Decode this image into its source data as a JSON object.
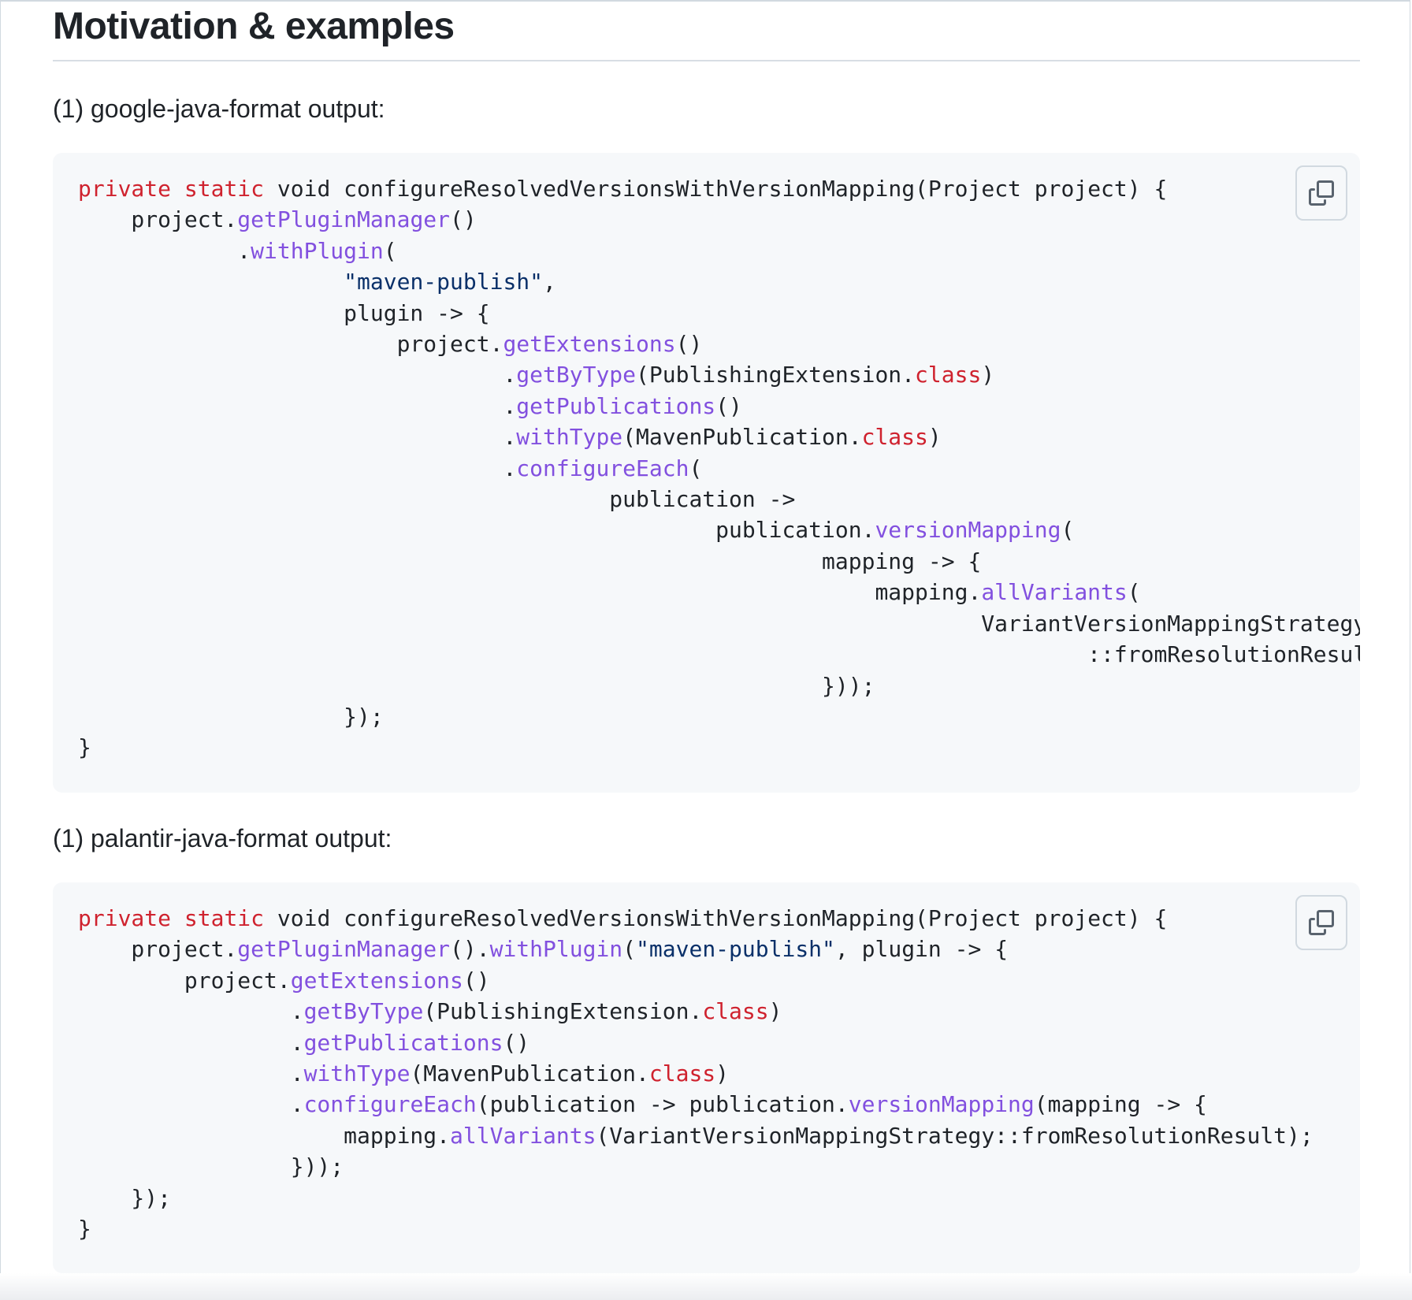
{
  "section": {
    "heading": "Motivation & examples"
  },
  "examples": [
    {
      "caption": "(1) google-java-format output:",
      "copy_icon": "copy-icon",
      "lines": [
        [
          [
            "kw",
            "private"
          ],
          [
            "t",
            " "
          ],
          [
            "kw",
            "static"
          ],
          [
            "t",
            " void configureResolvedVersionsWithVersionMapping(Project project) {"
          ]
        ],
        [
          [
            "t",
            "    project."
          ],
          [
            "fn",
            "getPluginManager"
          ],
          [
            "t",
            "()"
          ]
        ],
        [
          [
            "t",
            "            ."
          ],
          [
            "fn",
            "withPlugin"
          ],
          [
            "t",
            "("
          ]
        ],
        [
          [
            "t",
            "                    "
          ],
          [
            "str",
            "\"maven-publish\""
          ],
          [
            "t",
            ","
          ]
        ],
        [
          [
            "t",
            "                    plugin -> {"
          ]
        ],
        [
          [
            "t",
            "                        project."
          ],
          [
            "fn",
            "getExtensions"
          ],
          [
            "t",
            "()"
          ]
        ],
        [
          [
            "t",
            "                                ."
          ],
          [
            "fn",
            "getByType"
          ],
          [
            "t",
            "(PublishingExtension."
          ],
          [
            "kw",
            "class"
          ],
          [
            "t",
            ")"
          ]
        ],
        [
          [
            "t",
            "                                ."
          ],
          [
            "fn",
            "getPublications"
          ],
          [
            "t",
            "()"
          ]
        ],
        [
          [
            "t",
            "                                ."
          ],
          [
            "fn",
            "withType"
          ],
          [
            "t",
            "(MavenPublication."
          ],
          [
            "kw",
            "class"
          ],
          [
            "t",
            ")"
          ]
        ],
        [
          [
            "t",
            "                                ."
          ],
          [
            "fn",
            "configureEach"
          ],
          [
            "t",
            "("
          ]
        ],
        [
          [
            "t",
            "                                        publication ->"
          ]
        ],
        [
          [
            "t",
            "                                                publication."
          ],
          [
            "fn",
            "versionMapping"
          ],
          [
            "t",
            "("
          ]
        ],
        [
          [
            "t",
            "                                                        mapping -> {"
          ]
        ],
        [
          [
            "t",
            "                                                            mapping."
          ],
          [
            "fn",
            "allVariants"
          ],
          [
            "t",
            "("
          ]
        ],
        [
          [
            "t",
            "                                                                    VariantVersionMappingStrategy"
          ]
        ],
        [
          [
            "t",
            "                                                                            ::fromResolutionResult);"
          ]
        ],
        [
          [
            "t",
            "                                                        }));"
          ]
        ],
        [
          [
            "t",
            "                    });"
          ]
        ],
        [
          [
            "t",
            "}"
          ]
        ]
      ]
    },
    {
      "caption": "(1) palantir-java-format output:",
      "copy_icon": "copy-icon",
      "lines": [
        [
          [
            "kw",
            "private"
          ],
          [
            "t",
            " "
          ],
          [
            "kw",
            "static"
          ],
          [
            "t",
            " void configureResolvedVersionsWithVersionMapping(Project project) {"
          ]
        ],
        [
          [
            "t",
            "    project."
          ],
          [
            "fn",
            "getPluginManager"
          ],
          [
            "t",
            "()."
          ],
          [
            "fn",
            "withPlugin"
          ],
          [
            "t",
            "("
          ],
          [
            "str",
            "\"maven-publish\""
          ],
          [
            "t",
            ", plugin -> {"
          ]
        ],
        [
          [
            "t",
            "        project."
          ],
          [
            "fn",
            "getExtensions"
          ],
          [
            "t",
            "()"
          ]
        ],
        [
          [
            "t",
            "                ."
          ],
          [
            "fn",
            "getByType"
          ],
          [
            "t",
            "(PublishingExtension."
          ],
          [
            "kw",
            "class"
          ],
          [
            "t",
            ")"
          ]
        ],
        [
          [
            "t",
            "                ."
          ],
          [
            "fn",
            "getPublications"
          ],
          [
            "t",
            "()"
          ]
        ],
        [
          [
            "t",
            "                ."
          ],
          [
            "fn",
            "withType"
          ],
          [
            "t",
            "(MavenPublication."
          ],
          [
            "kw",
            "class"
          ],
          [
            "t",
            ")"
          ]
        ],
        [
          [
            "t",
            "                ."
          ],
          [
            "fn",
            "configureEach"
          ],
          [
            "t",
            "(publication -> publication."
          ],
          [
            "fn",
            "versionMapping"
          ],
          [
            "t",
            "(mapping -> {"
          ]
        ],
        [
          [
            "t",
            "                    mapping."
          ],
          [
            "fn",
            "allVariants"
          ],
          [
            "t",
            "(VariantVersionMappingStrategy::fromResolutionResult);"
          ]
        ],
        [
          [
            "t",
            "                }));"
          ]
        ],
        [
          [
            "t",
            "    });"
          ]
        ],
        [
          [
            "t",
            "}"
          ]
        ]
      ]
    }
  ]
}
